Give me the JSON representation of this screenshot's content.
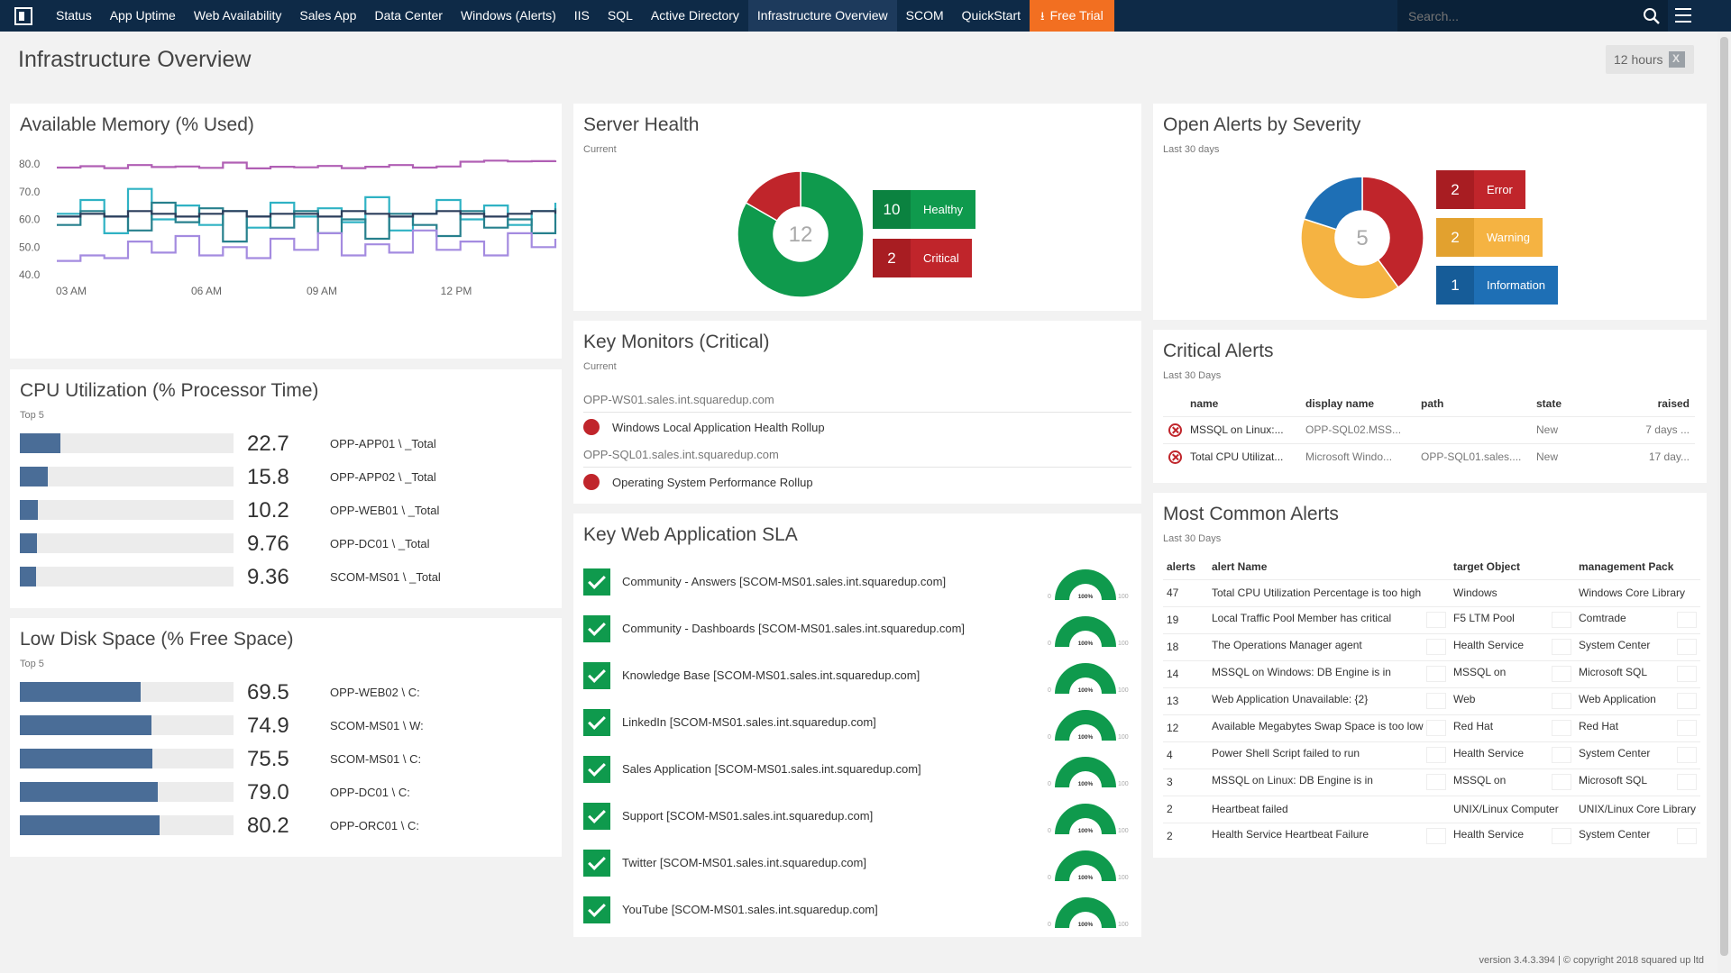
{
  "nav": {
    "items": [
      "Status",
      "App Uptime",
      "Web Availability",
      "Sales App",
      "Data Center",
      "Windows (Alerts)",
      "IIS",
      "SQL",
      "Active Directory",
      "Infrastructure Overview",
      "SCOM",
      "QuickStart"
    ],
    "active": "Infrastructure Overview",
    "trial": "Free Trial",
    "search_placeholder": "Search..."
  },
  "header": {
    "title": "Infrastructure Overview",
    "timeframe": "12 hours"
  },
  "memory": {
    "title": "Available Memory (% Used)",
    "chart_data": {
      "type": "line",
      "yticks": [
        "80.0",
        "70.0",
        "60.0",
        "50.0",
        "40.0"
      ],
      "xticks": [
        "03 AM",
        "06 AM",
        "09 AM",
        "12 PM"
      ],
      "ylim": [
        40,
        80
      ],
      "series": [
        {
          "color": "#b05fb4",
          "values": [
            78.7,
            79.2,
            78.5,
            79.6,
            78.9,
            79.1,
            78.6,
            80.5,
            78.4,
            79.0,
            78.8,
            79.3,
            78.5,
            79.0,
            79.6,
            78.7,
            79.1,
            80.8,
            81.2,
            80.9,
            81.0,
            81.3
          ]
        },
        {
          "color": "#2fb2c4",
          "values": [
            62,
            67,
            55,
            71,
            60,
            65,
            58,
            63,
            57,
            66,
            61,
            64,
            59,
            68,
            56,
            62,
            67,
            60,
            65,
            58,
            63,
            66
          ]
        },
        {
          "color": "#27808d",
          "values": [
            58,
            63,
            61,
            56,
            66,
            59,
            64,
            52,
            61,
            57,
            63,
            55,
            60,
            53,
            62,
            58,
            54,
            63,
            57,
            60,
            55,
            64
          ]
        },
        {
          "color": "#2c3e5c",
          "values": [
            61,
            62,
            61,
            63,
            62,
            61,
            62,
            63,
            61,
            62,
            62,
            61,
            63,
            62,
            61,
            62,
            63,
            62,
            61,
            62,
            63,
            62
          ]
        },
        {
          "color": "#a48be0",
          "values": [
            45,
            47,
            46,
            52,
            48,
            54,
            47,
            50,
            46,
            53,
            49,
            55,
            47,
            51,
            48,
            56,
            49,
            52,
            47,
            55,
            50,
            53
          ]
        }
      ]
    }
  },
  "cpu": {
    "title": "CPU Utilization (% Processor Time)",
    "sub": "Top 5",
    "rows": [
      {
        "value": "22.7",
        "label": "OPP-APP01 \\ _Total",
        "pct": 0.19
      },
      {
        "value": "15.8",
        "label": "OPP-APP02 \\ _Total",
        "pct": 0.13
      },
      {
        "value": "10.2",
        "label": "OPP-WEB01 \\ _Total",
        "pct": 0.085
      },
      {
        "value": "9.76",
        "label": "OPP-DC01 \\ _Total",
        "pct": 0.08
      },
      {
        "value": "9.36",
        "label": "SCOM-MS01 \\ _Total",
        "pct": 0.075
      }
    ]
  },
  "disk": {
    "title": "Low Disk Space (% Free Space)",
    "sub": "Top 5",
    "rows": [
      {
        "value": "69.5",
        "label": "OPP-WEB02 \\ C:",
        "pct": 0.565
      },
      {
        "value": "74.9",
        "label": "SCOM-MS01 \\ W:",
        "pct": 0.615
      },
      {
        "value": "75.5",
        "label": "SCOM-MS01 \\ C:",
        "pct": 0.62
      },
      {
        "value": "79.0",
        "label": "OPP-DC01 \\ C:",
        "pct": 0.645
      },
      {
        "value": "80.2",
        "label": "OPP-ORC01 \\ C:",
        "pct": 0.655
      }
    ]
  },
  "server_health": {
    "title": "Server Health",
    "sub": "Current",
    "total": "12",
    "chart_data": {
      "type": "pie",
      "slices": [
        {
          "label": "Healthy",
          "value": 10,
          "color": "#0f9a4d"
        },
        {
          "label": "Critical",
          "value": 2,
          "color": "#c0252b"
        }
      ]
    },
    "healthy": {
      "num": "10",
      "label": "Healthy"
    },
    "critical": {
      "num": "2",
      "label": "Critical"
    }
  },
  "key_monitors": {
    "title": "Key Monitors (Critical)",
    "sub": "Current",
    "groups": [
      {
        "host": "OPP-WS01.sales.int.squaredup.com",
        "monitor": "Windows Local Application Health Rollup"
      },
      {
        "host": "OPP-SQL01.sales.int.squaredup.com",
        "monitor": "Operating System Performance Rollup"
      }
    ]
  },
  "sla": {
    "title": "Key Web Application SLA",
    "gauge_min": "0",
    "gauge_max": "100",
    "gauge_value": "100%",
    "items": [
      "Community - Answers [SCOM-MS01.sales.int.squaredup.com]",
      "Community - Dashboards [SCOM-MS01.sales.int.squaredup.com]",
      "Knowledge Base [SCOM-MS01.sales.int.squaredup.com]",
      "LinkedIn [SCOM-MS01.sales.int.squaredup.com]",
      "Sales Application [SCOM-MS01.sales.int.squaredup.com]",
      "Support [SCOM-MS01.sales.int.squaredup.com]",
      "Twitter [SCOM-MS01.sales.int.squaredup.com]",
      "YouTube [SCOM-MS01.sales.int.squaredup.com]"
    ]
  },
  "alerts_severity": {
    "title": "Open Alerts by Severity",
    "sub": "Last 30 days",
    "total": "5",
    "chart_data": {
      "type": "pie",
      "slices": [
        {
          "label": "Error",
          "value": 2,
          "color": "#c0252b"
        },
        {
          "label": "Warning",
          "value": 2,
          "color": "#f5b342"
        },
        {
          "label": "Information",
          "value": 1,
          "color": "#1e6fb5"
        }
      ]
    },
    "error": {
      "num": "2",
      "label": "Error"
    },
    "warning": {
      "num": "2",
      "label": "Warning"
    },
    "info": {
      "num": "1",
      "label": "Information"
    }
  },
  "critical_alerts": {
    "title": "Critical Alerts",
    "sub": "Last 30 Days",
    "headers": [
      "name",
      "display name",
      "path",
      "state",
      "raised"
    ],
    "rows": [
      [
        "MSSQL on Linux:...",
        "OPP-SQL02.MSS...",
        "",
        "New",
        "7 days ..."
      ],
      [
        "Total CPU Utilizat...",
        "Microsoft Windo...",
        "OPP-SQL01.sales....",
        "New",
        "17 day..."
      ]
    ]
  },
  "common_alerts": {
    "title": "Most Common Alerts",
    "sub": "Last 30 Days",
    "headers": [
      "alerts",
      "alert Name",
      "target Object",
      "management Pack"
    ],
    "rows": [
      [
        "47",
        "Total CPU Utilization Percentage is too high",
        "Windows",
        "Windows Core Library"
      ],
      [
        "19",
        "Local Traffic Pool Member has critical",
        "F5 LTM Pool",
        "Comtrade"
      ],
      [
        "18",
        "The Operations Manager agent",
        "Health Service",
        "System Center"
      ],
      [
        "14",
        "MSSQL on Windows: DB Engine is in",
        "MSSQL on",
        "Microsoft SQL"
      ],
      [
        "13",
        "Web Application Unavailable: {2}",
        "Web",
        "Web Application"
      ],
      [
        "12",
        "Available Megabytes Swap Space is too low",
        "Red Hat",
        "Red Hat"
      ],
      [
        "4",
        "Power Shell Script failed to run",
        "Health Service",
        "System Center"
      ],
      [
        "3",
        "MSSQL on Linux: DB Engine is in",
        "MSSQL on",
        "Microsoft SQL"
      ],
      [
        "2",
        "Heartbeat failed",
        "UNIX/Linux Computer",
        "UNIX/Linux Core Library"
      ],
      [
        "2",
        "Health Service Heartbeat Failure",
        "Health Service",
        "System Center"
      ]
    ]
  },
  "footer": "version 3.4.3.394  |  © copyright 2018 squared up ltd"
}
